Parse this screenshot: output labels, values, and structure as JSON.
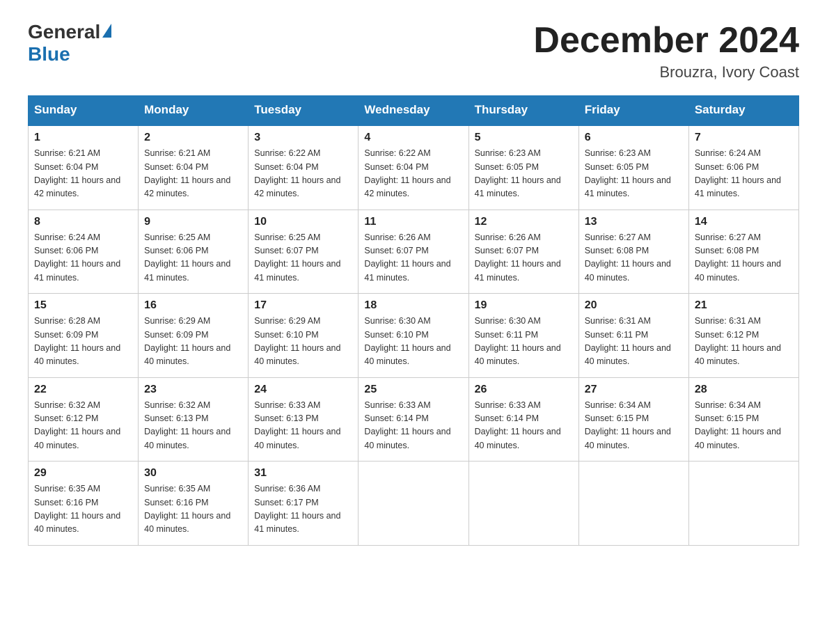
{
  "header": {
    "logo_general": "General",
    "logo_blue": "Blue",
    "month_title": "December 2024",
    "location": "Brouzra, Ivory Coast"
  },
  "days_of_week": [
    "Sunday",
    "Monday",
    "Tuesday",
    "Wednesday",
    "Thursday",
    "Friday",
    "Saturday"
  ],
  "weeks": [
    [
      {
        "day": "1",
        "sunrise": "6:21 AM",
        "sunset": "6:04 PM",
        "daylight": "11 hours and 42 minutes."
      },
      {
        "day": "2",
        "sunrise": "6:21 AM",
        "sunset": "6:04 PM",
        "daylight": "11 hours and 42 minutes."
      },
      {
        "day": "3",
        "sunrise": "6:22 AM",
        "sunset": "6:04 PM",
        "daylight": "11 hours and 42 minutes."
      },
      {
        "day": "4",
        "sunrise": "6:22 AM",
        "sunset": "6:04 PM",
        "daylight": "11 hours and 42 minutes."
      },
      {
        "day": "5",
        "sunrise": "6:23 AM",
        "sunset": "6:05 PM",
        "daylight": "11 hours and 41 minutes."
      },
      {
        "day": "6",
        "sunrise": "6:23 AM",
        "sunset": "6:05 PM",
        "daylight": "11 hours and 41 minutes."
      },
      {
        "day": "7",
        "sunrise": "6:24 AM",
        "sunset": "6:06 PM",
        "daylight": "11 hours and 41 minutes."
      }
    ],
    [
      {
        "day": "8",
        "sunrise": "6:24 AM",
        "sunset": "6:06 PM",
        "daylight": "11 hours and 41 minutes."
      },
      {
        "day": "9",
        "sunrise": "6:25 AM",
        "sunset": "6:06 PM",
        "daylight": "11 hours and 41 minutes."
      },
      {
        "day": "10",
        "sunrise": "6:25 AM",
        "sunset": "6:07 PM",
        "daylight": "11 hours and 41 minutes."
      },
      {
        "day": "11",
        "sunrise": "6:26 AM",
        "sunset": "6:07 PM",
        "daylight": "11 hours and 41 minutes."
      },
      {
        "day": "12",
        "sunrise": "6:26 AM",
        "sunset": "6:07 PM",
        "daylight": "11 hours and 41 minutes."
      },
      {
        "day": "13",
        "sunrise": "6:27 AM",
        "sunset": "6:08 PM",
        "daylight": "11 hours and 40 minutes."
      },
      {
        "day": "14",
        "sunrise": "6:27 AM",
        "sunset": "6:08 PM",
        "daylight": "11 hours and 40 minutes."
      }
    ],
    [
      {
        "day": "15",
        "sunrise": "6:28 AM",
        "sunset": "6:09 PM",
        "daylight": "11 hours and 40 minutes."
      },
      {
        "day": "16",
        "sunrise": "6:29 AM",
        "sunset": "6:09 PM",
        "daylight": "11 hours and 40 minutes."
      },
      {
        "day": "17",
        "sunrise": "6:29 AM",
        "sunset": "6:10 PM",
        "daylight": "11 hours and 40 minutes."
      },
      {
        "day": "18",
        "sunrise": "6:30 AM",
        "sunset": "6:10 PM",
        "daylight": "11 hours and 40 minutes."
      },
      {
        "day": "19",
        "sunrise": "6:30 AM",
        "sunset": "6:11 PM",
        "daylight": "11 hours and 40 minutes."
      },
      {
        "day": "20",
        "sunrise": "6:31 AM",
        "sunset": "6:11 PM",
        "daylight": "11 hours and 40 minutes."
      },
      {
        "day": "21",
        "sunrise": "6:31 AM",
        "sunset": "6:12 PM",
        "daylight": "11 hours and 40 minutes."
      }
    ],
    [
      {
        "day": "22",
        "sunrise": "6:32 AM",
        "sunset": "6:12 PM",
        "daylight": "11 hours and 40 minutes."
      },
      {
        "day": "23",
        "sunrise": "6:32 AM",
        "sunset": "6:13 PM",
        "daylight": "11 hours and 40 minutes."
      },
      {
        "day": "24",
        "sunrise": "6:33 AM",
        "sunset": "6:13 PM",
        "daylight": "11 hours and 40 minutes."
      },
      {
        "day": "25",
        "sunrise": "6:33 AM",
        "sunset": "6:14 PM",
        "daylight": "11 hours and 40 minutes."
      },
      {
        "day": "26",
        "sunrise": "6:33 AM",
        "sunset": "6:14 PM",
        "daylight": "11 hours and 40 minutes."
      },
      {
        "day": "27",
        "sunrise": "6:34 AM",
        "sunset": "6:15 PM",
        "daylight": "11 hours and 40 minutes."
      },
      {
        "day": "28",
        "sunrise": "6:34 AM",
        "sunset": "6:15 PM",
        "daylight": "11 hours and 40 minutes."
      }
    ],
    [
      {
        "day": "29",
        "sunrise": "6:35 AM",
        "sunset": "6:16 PM",
        "daylight": "11 hours and 40 minutes."
      },
      {
        "day": "30",
        "sunrise": "6:35 AM",
        "sunset": "6:16 PM",
        "daylight": "11 hours and 40 minutes."
      },
      {
        "day": "31",
        "sunrise": "6:36 AM",
        "sunset": "6:17 PM",
        "daylight": "11 hours and 41 minutes."
      },
      null,
      null,
      null,
      null
    ]
  ],
  "labels": {
    "sunrise": "Sunrise:",
    "sunset": "Sunset:",
    "daylight": "Daylight:"
  }
}
